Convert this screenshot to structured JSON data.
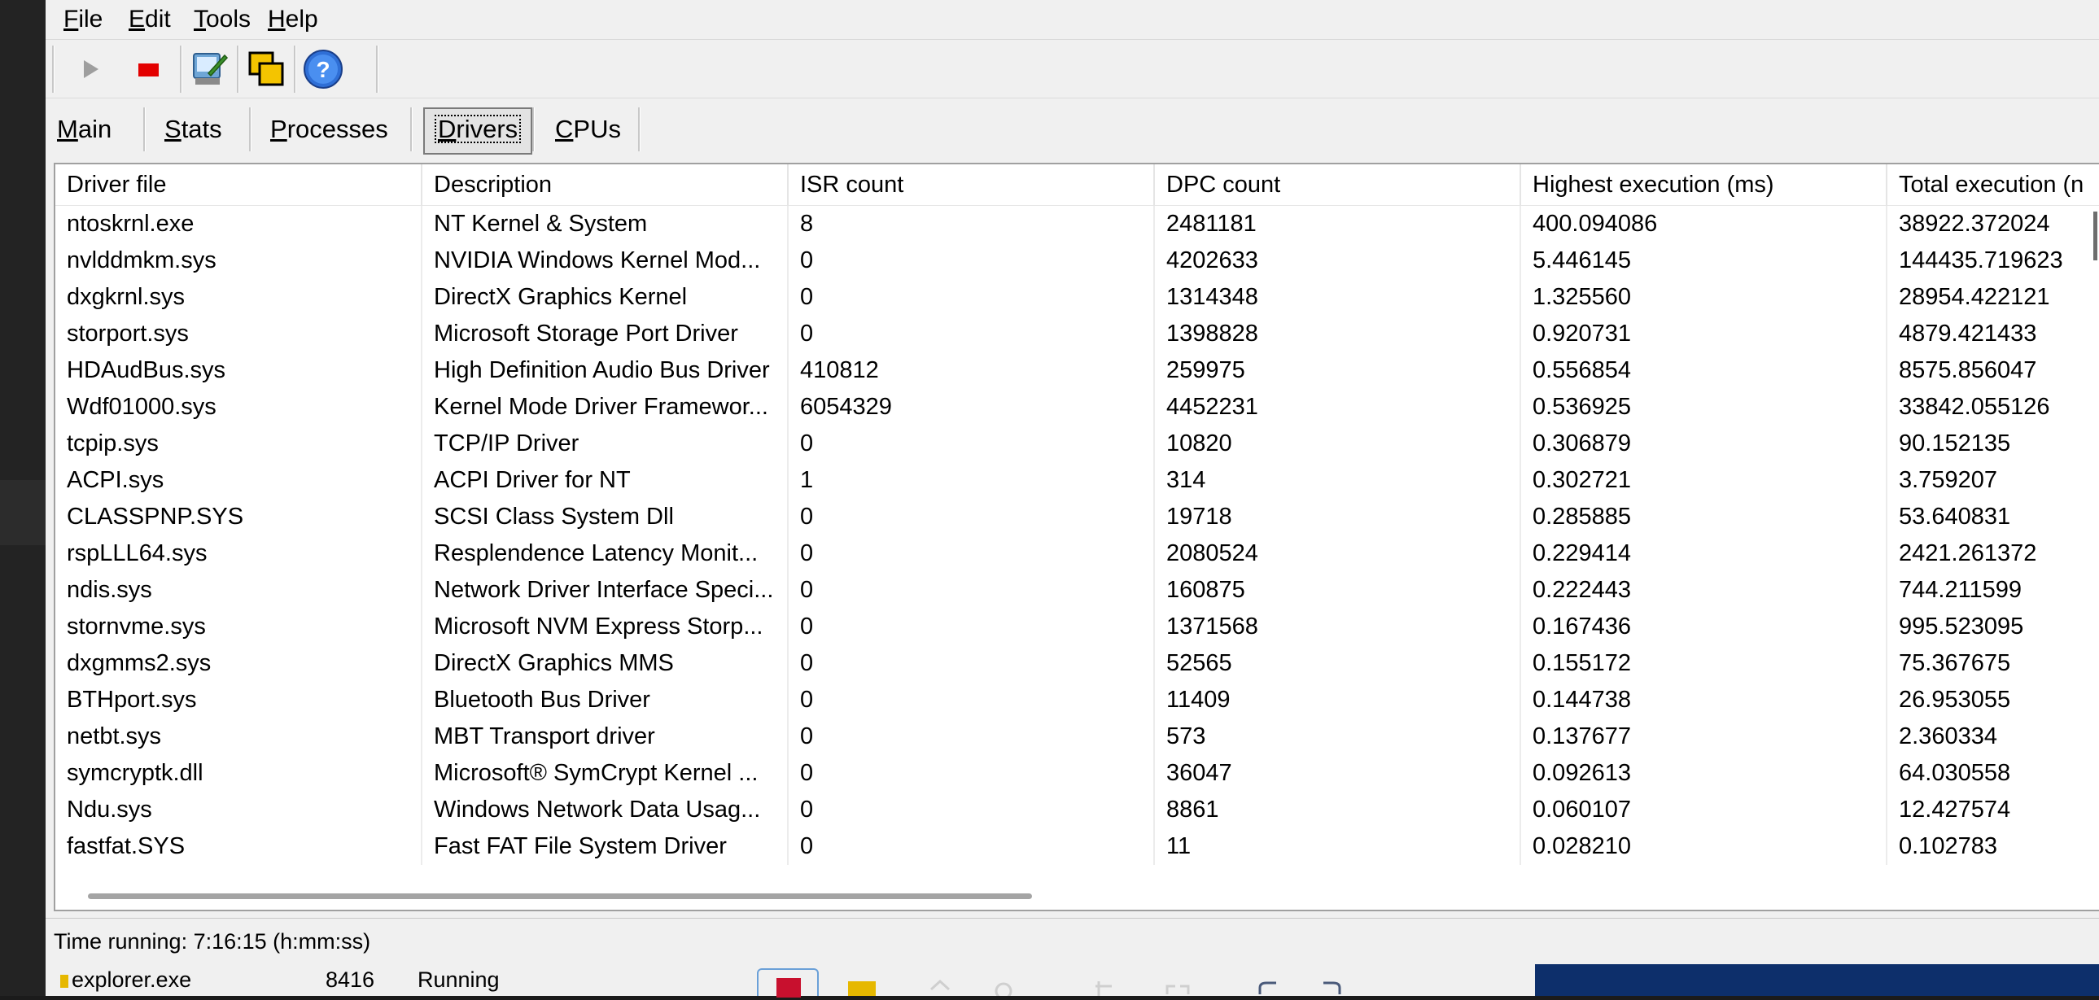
{
  "menubar": {
    "items": [
      {
        "key": "F",
        "rest": "ile"
      },
      {
        "key": "E",
        "rest": "dit"
      },
      {
        "key": "T",
        "rest": "ools"
      },
      {
        "key": "H",
        "rest": "elp"
      }
    ]
  },
  "toolbar": {
    "buttons": [
      "play-icon",
      "stop-icon",
      "settings-wizard-icon",
      "copy-windows-icon",
      "help-icon"
    ]
  },
  "tabs": [
    {
      "key": "M",
      "rest": "ain",
      "selected": false
    },
    {
      "key": "S",
      "rest": "tats",
      "selected": false
    },
    {
      "key": "P",
      "rest": "rocesses",
      "selected": false
    },
    {
      "key": "D",
      "rest": "rivers",
      "selected": true
    },
    {
      "key": "C",
      "rest": "PUs",
      "selected": false
    }
  ],
  "table": {
    "columns": [
      "Driver file",
      "Description",
      "ISR count",
      "DPC count",
      "Highest execution (ms)",
      "Total execution (n"
    ],
    "rows": [
      [
        "ntoskrnl.exe",
        "NT Kernel & System",
        "8",
        "2481181",
        "400.094086",
        "38922.372024"
      ],
      [
        "nvlddmkm.sys",
        "NVIDIA Windows Kernel Mod...",
        "0",
        "4202633",
        "5.446145",
        "144435.719623"
      ],
      [
        "dxgkrnl.sys",
        "DirectX Graphics Kernel",
        "0",
        "1314348",
        "1.325560",
        "28954.422121"
      ],
      [
        "storport.sys",
        "Microsoft Storage Port Driver",
        "0",
        "1398828",
        "0.920731",
        "4879.421433"
      ],
      [
        "HDAudBus.sys",
        "High Definition Audio Bus Driver",
        "410812",
        "259975",
        "0.556854",
        "8575.856047"
      ],
      [
        "Wdf01000.sys",
        "Kernel Mode Driver Framewor...",
        "6054329",
        "4452231",
        "0.536925",
        "33842.055126"
      ],
      [
        "tcpip.sys",
        "TCP/IP Driver",
        "0",
        "10820",
        "0.306879",
        "90.152135"
      ],
      [
        "ACPI.sys",
        "ACPI Driver for NT",
        "1",
        "314",
        "0.302721",
        "3.759207"
      ],
      [
        "CLASSPNP.SYS",
        "SCSI Class System Dll",
        "0",
        "19718",
        "0.285885",
        "53.640831"
      ],
      [
        "rspLLL64.sys",
        "Resplendence Latency Monit...",
        "0",
        "2080524",
        "0.229414",
        "2421.261372"
      ],
      [
        "ndis.sys",
        "Network Driver Interface Speci...",
        "0",
        "160875",
        "0.222443",
        "744.211599"
      ],
      [
        "stornvme.sys",
        "Microsoft NVM Express Storp...",
        "0",
        "1371568",
        "0.167436",
        "995.523095"
      ],
      [
        "dxgmms2.sys",
        "DirectX Graphics MMS",
        "0",
        "52565",
        "0.155172",
        "75.367675"
      ],
      [
        "BTHport.sys",
        "Bluetooth Bus Driver",
        "0",
        "11409",
        "0.144738",
        "26.953055"
      ],
      [
        "netbt.sys",
        "MBT Transport driver",
        "0",
        "573",
        "0.137677",
        "2.360334"
      ],
      [
        "symcryptk.dll",
        "Microsoft® SymCrypt Kernel ...",
        "0",
        "36047",
        "0.092613",
        "64.030558"
      ],
      [
        "Ndu.sys",
        "Windows Network Data Usag...",
        "0",
        "8861",
        "0.060107",
        "12.427574"
      ],
      [
        "fastfat.SYS",
        "Fast FAT File System Driver",
        "0",
        "11",
        "0.028210",
        "0.102783"
      ]
    ]
  },
  "status": {
    "time_running": "Time running: 7:16:15  (h:mm:ss)"
  },
  "background_process_row": {
    "name": "explorer.exe",
    "pid": "8416",
    "state": "Running"
  }
}
